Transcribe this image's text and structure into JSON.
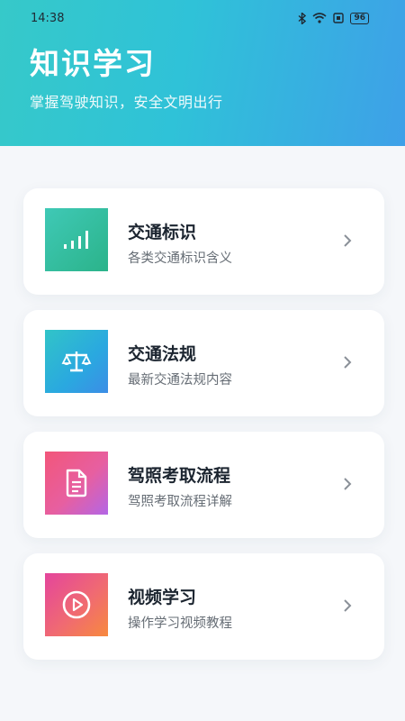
{
  "status_bar": {
    "time": "14:38",
    "battery": "96",
    "icons": [
      "bluetooth-icon",
      "wifi-icon",
      "sim-icon",
      "battery-icon"
    ]
  },
  "header": {
    "title": "知识学习",
    "subtitle": "掌握驾驶知识，安全文明出行"
  },
  "cards": [
    {
      "title": "交通标识",
      "desc": "各类交通标识含义",
      "icon": "signal-bars-icon"
    },
    {
      "title": "交通法规",
      "desc": "最新交通法规内容",
      "icon": "scale-icon"
    },
    {
      "title": "驾照考取流程",
      "desc": "驾照考取流程详解",
      "icon": "document-icon"
    },
    {
      "title": "视频学习",
      "desc": "操作学习视频教程",
      "icon": "play-icon"
    }
  ],
  "colors": {
    "header_start": "#36c9c9",
    "header_end": "#3ea0e8",
    "card_1": "#2fbf9a",
    "card_2": "#2fb8d8",
    "card_3": "#f06a8c",
    "card_4": "#f47a5a"
  }
}
